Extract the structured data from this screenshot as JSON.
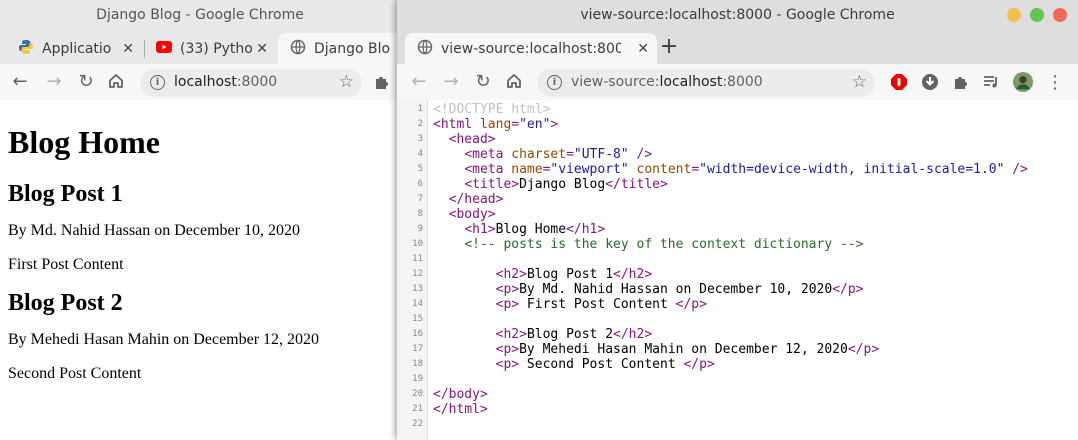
{
  "left_window": {
    "title": "Django Blog - Google Chrome",
    "tabs": [
      {
        "label": "Applicatio"
      },
      {
        "label": "(33) Pytho"
      },
      {
        "label": "Django Blo"
      }
    ],
    "url_host": "localhost",
    "url_port": ":8000",
    "page": {
      "h1": "Blog Home",
      "posts": [
        {
          "title": "Blog Post 1",
          "byline": "By Md. Nahid Hassan on December 10, 2020",
          "content": "First Post Content"
        },
        {
          "title": "Blog Post 2",
          "byline": "By Mehedi Hasan Mahin on December 12, 2020",
          "content": "Second Post Content"
        }
      ]
    }
  },
  "right_window": {
    "title": "view-source:localhost:8000 - Google Chrome",
    "tab_label": "view-source:localhost:800",
    "url_prefix": "view-source:",
    "url_host": "localhost",
    "url_port": ":8000",
    "source_lines": [
      [
        {
          "c": "d",
          "t": "<!DOCTYPE html>"
        }
      ],
      [
        {
          "c": "t",
          "t": "<html "
        },
        {
          "c": "a",
          "t": "lang"
        },
        {
          "c": "t",
          "t": "="
        },
        {
          "c": "v",
          "t": "\"en\""
        },
        {
          "c": "t",
          "t": ">"
        }
      ],
      [
        {
          "c": "x",
          "t": "  "
        },
        {
          "c": "t",
          "t": "<head>"
        }
      ],
      [
        {
          "c": "x",
          "t": "    "
        },
        {
          "c": "t",
          "t": "<meta "
        },
        {
          "c": "a",
          "t": "charset"
        },
        {
          "c": "t",
          "t": "="
        },
        {
          "c": "v",
          "t": "\"UTF-8\""
        },
        {
          "c": "t",
          "t": " />"
        }
      ],
      [
        {
          "c": "x",
          "t": "    "
        },
        {
          "c": "t",
          "t": "<meta "
        },
        {
          "c": "a",
          "t": "name"
        },
        {
          "c": "t",
          "t": "="
        },
        {
          "c": "v",
          "t": "\"viewport\""
        },
        {
          "c": "t",
          "t": " "
        },
        {
          "c": "a",
          "t": "content"
        },
        {
          "c": "t",
          "t": "="
        },
        {
          "c": "v",
          "t": "\"width=device-width, initial-scale=1.0\""
        },
        {
          "c": "t",
          "t": " />"
        }
      ],
      [
        {
          "c": "x",
          "t": "    "
        },
        {
          "c": "t",
          "t": "<title>"
        },
        {
          "c": "x",
          "t": "Django Blog"
        },
        {
          "c": "t",
          "t": "</title>"
        }
      ],
      [
        {
          "c": "x",
          "t": "  "
        },
        {
          "c": "t",
          "t": "</head>"
        }
      ],
      [
        {
          "c": "x",
          "t": "  "
        },
        {
          "c": "t",
          "t": "<body>"
        }
      ],
      [
        {
          "c": "x",
          "t": "    "
        },
        {
          "c": "t",
          "t": "<h1>"
        },
        {
          "c": "x",
          "t": "Blog Home"
        },
        {
          "c": "t",
          "t": "</h1>"
        }
      ],
      [
        {
          "c": "x",
          "t": "    "
        },
        {
          "c": "c",
          "t": "<!-- posts is the key of the context dictionary -->"
        }
      ],
      [],
      [
        {
          "c": "x",
          "t": "        "
        },
        {
          "c": "t",
          "t": "<h2>"
        },
        {
          "c": "x",
          "t": "Blog Post 1"
        },
        {
          "c": "t",
          "t": "</h2>"
        }
      ],
      [
        {
          "c": "x",
          "t": "        "
        },
        {
          "c": "t",
          "t": "<p>"
        },
        {
          "c": "x",
          "t": "By Md. Nahid Hassan on December 10, 2020"
        },
        {
          "c": "t",
          "t": "</p>"
        }
      ],
      [
        {
          "c": "x",
          "t": "        "
        },
        {
          "c": "t",
          "t": "<p>"
        },
        {
          "c": "x",
          "t": " First Post Content "
        },
        {
          "c": "t",
          "t": "</p>"
        }
      ],
      [],
      [
        {
          "c": "x",
          "t": "        "
        },
        {
          "c": "t",
          "t": "<h2>"
        },
        {
          "c": "x",
          "t": "Blog Post 2"
        },
        {
          "c": "t",
          "t": "</h2>"
        }
      ],
      [
        {
          "c": "x",
          "t": "        "
        },
        {
          "c": "t",
          "t": "<p>"
        },
        {
          "c": "x",
          "t": "By Mehedi Hasan Mahin on December 12, 2020"
        },
        {
          "c": "t",
          "t": "</p>"
        }
      ],
      [
        {
          "c": "x",
          "t": "        "
        },
        {
          "c": "t",
          "t": "<p>"
        },
        {
          "c": "x",
          "t": " Second Post Content "
        },
        {
          "c": "t",
          "t": "</p>"
        }
      ],
      [],
      [
        {
          "c": "t",
          "t": "</body>"
        }
      ],
      [
        {
          "c": "t",
          "t": "</html>"
        }
      ],
      []
    ]
  },
  "colors": {
    "tag": "#881280",
    "attribute": "#994500",
    "value": "#1a1aa6",
    "comment": "#236e25",
    "window_close": "#ed6a5e",
    "window_min": "#f5bf4f",
    "window_max": "#62c554"
  }
}
